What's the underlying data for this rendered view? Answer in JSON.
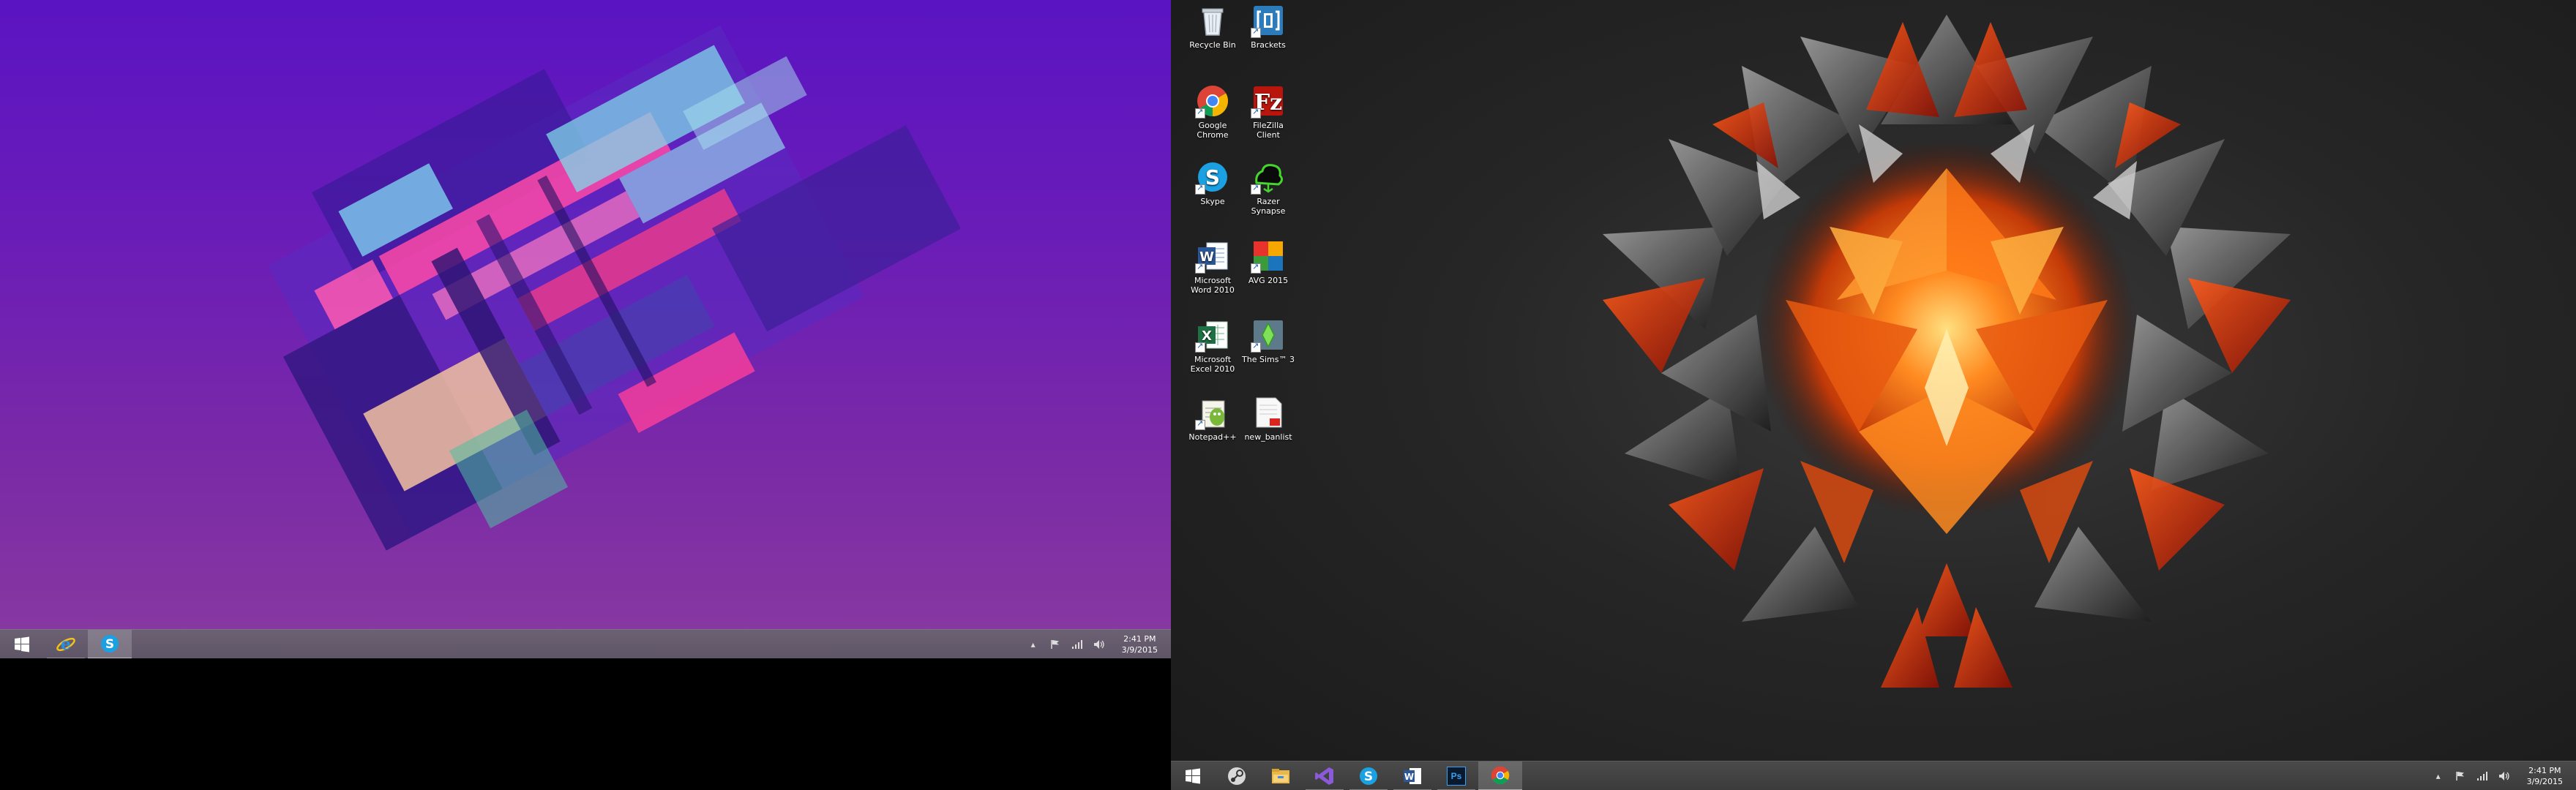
{
  "left_monitor": {
    "taskbar": {
      "buttons": [
        {
          "name": "start-button",
          "icon": "windows-logo-icon"
        },
        {
          "name": "internet-explorer-button",
          "icon": "internet-explorer-icon"
        },
        {
          "name": "skype-button",
          "icon": "skype-icon",
          "active": true
        }
      ],
      "tray_icons": [
        "show-hidden-icons-chevron-icon",
        "action-center-flag-icon",
        "network-icon",
        "volume-icon"
      ],
      "clock": {
        "time": "2:41 PM",
        "date": "3/9/2015"
      }
    }
  },
  "right_monitor": {
    "desktop_icons": [
      {
        "label": "Recycle Bin",
        "icon": "recycle-bin-icon"
      },
      {
        "label": "Brackets",
        "icon": "brackets-icon"
      },
      {
        "label": "Google Chrome",
        "icon": "google-chrome-icon"
      },
      {
        "label": "FileZilla Client",
        "icon": "filezilla-icon"
      },
      {
        "label": "Skype",
        "icon": "skype-icon"
      },
      {
        "label": "Razer Synapse",
        "icon": "razer-synapse-icon"
      },
      {
        "label": "Microsoft Word 2010",
        "icon": "microsoft-word-icon"
      },
      {
        "label": "AVG 2015",
        "icon": "avg-icon"
      },
      {
        "label": "Microsoft Excel 2010",
        "icon": "microsoft-excel-icon"
      },
      {
        "label": "The Sims™ 3",
        "icon": "the-sims-3-icon"
      },
      {
        "label": "Notepad++",
        "icon": "notepad-plus-plus-icon"
      },
      {
        "label": "new_banlist",
        "icon": "pdf-document-icon"
      }
    ],
    "taskbar": {
      "buttons": [
        {
          "name": "start-button",
          "icon": "windows-logo-icon"
        },
        {
          "name": "steam-button",
          "icon": "steam-icon"
        },
        {
          "name": "file-explorer-button",
          "icon": "file-explorer-icon"
        },
        {
          "name": "visual-studio-button",
          "icon": "visual-studio-icon"
        },
        {
          "name": "skype-button",
          "icon": "skype-icon"
        },
        {
          "name": "microsoft-word-button",
          "icon": "microsoft-word-icon"
        },
        {
          "name": "photoshop-button",
          "icon": "photoshop-icon",
          "text": "Ps"
        },
        {
          "name": "google-chrome-button",
          "icon": "google-chrome-icon",
          "active": true
        }
      ],
      "tray_icons": [
        "show-hidden-icons-chevron-icon",
        "action-center-flag-icon",
        "network-icon",
        "volume-icon"
      ],
      "clock": {
        "time": "2:41 PM",
        "date": "3/9/2015"
      }
    }
  },
  "colors": {
    "left_wallpaper_bg": "#6a1cb8",
    "right_wallpaper_bg": "#262626",
    "accent_orange": "#ff6a10",
    "accent_pink": "#ff3f9a",
    "accent_cyan": "#7fd8e8"
  }
}
